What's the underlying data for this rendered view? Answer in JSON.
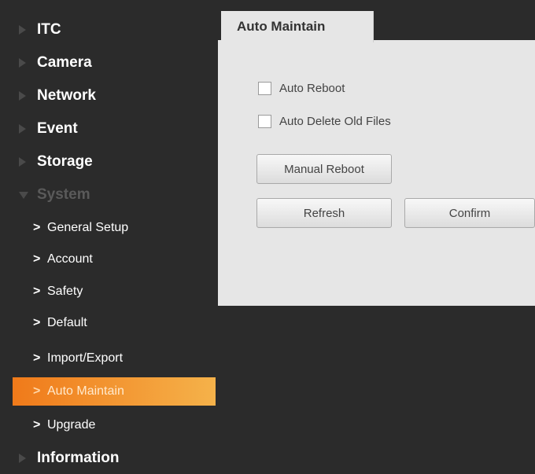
{
  "sidebar": {
    "items": [
      {
        "label": "ITC"
      },
      {
        "label": "Camera"
      },
      {
        "label": "Network"
      },
      {
        "label": "Event"
      },
      {
        "label": "Storage"
      },
      {
        "label": "System"
      }
    ],
    "system_children": [
      {
        "label": "General Setup"
      },
      {
        "label": "Account"
      },
      {
        "label": "Safety"
      },
      {
        "label": "Default"
      },
      {
        "label": "Import/Export"
      },
      {
        "label": "Auto Maintain"
      },
      {
        "label": "Upgrade"
      }
    ],
    "information": {
      "label": "Information"
    },
    "active_item": "Auto Maintain"
  },
  "main": {
    "tab_label": "Auto Maintain",
    "auto_reboot_label": "Auto Reboot",
    "auto_delete_label": "Auto Delete Old Files",
    "manual_reboot_label": "Manual Reboot",
    "refresh_label": "Refresh",
    "confirm_label": "Confirm"
  },
  "colors": {
    "background": "#2b2b2b",
    "panel": "#e6e6e6",
    "accent": "#f07a1a"
  }
}
